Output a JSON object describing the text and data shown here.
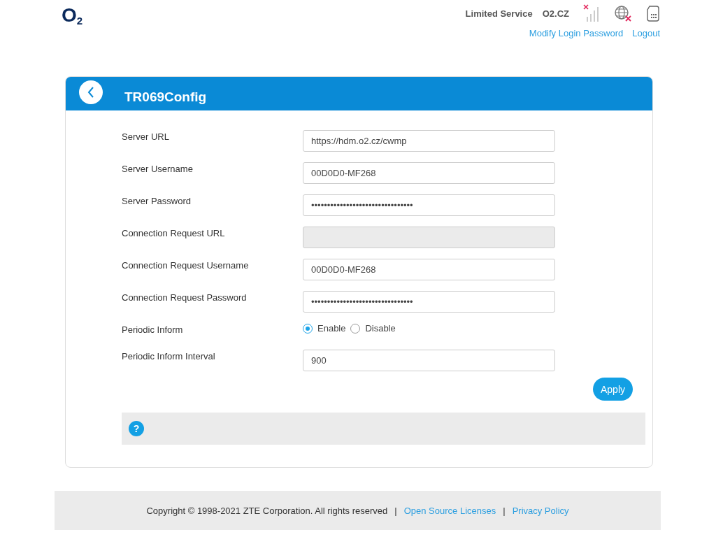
{
  "header": {
    "logo": "O$_{2}$",
    "service_status": "Limited Service",
    "operator": "O2.CZ",
    "links": [
      {
        "label": "Modify Login Password"
      },
      {
        "label": "Logout"
      }
    ]
  },
  "panel": {
    "title": "TR069Config",
    "fields": [
      {
        "kind": "text",
        "label": "Server URL",
        "value": "https://hdm.o2.cz/cwmp"
      },
      {
        "kind": "text",
        "label": "Server Username",
        "value": "00D0D0-MF268"
      },
      {
        "kind": "text",
        "label": "Server Password",
        "value": "••••••••••••••••••••••••••••••••"
      },
      {
        "kind": "disabled",
        "label": "Connection Request URL"
      },
      {
        "kind": "text",
        "label": "Connection Request Username",
        "value": "00D0D0-MF268"
      },
      {
        "kind": "text",
        "label": "Connection Request Password",
        "value": "••••••••••••••••••••••••••••••••"
      },
      {
        "kind": "radio",
        "label": "Periodic Inform",
        "options": [
          {
            "label": "Enable",
            "selected": true
          },
          {
            "label": "Disable",
            "selected": false
          }
        ]
      },
      {
        "kind": "text",
        "label": "Periodic Inform Interval",
        "value": "900"
      }
    ],
    "apply_button": "Apply",
    "help_icon": "?"
  },
  "footer": {
    "copyright": "Copyright © 1998-2021 ZTE Corporation. All rights reserved",
    "separators": [
      "|",
      "|"
    ],
    "links": [
      "Open Source Licenses",
      "Privacy Policy"
    ]
  }
}
